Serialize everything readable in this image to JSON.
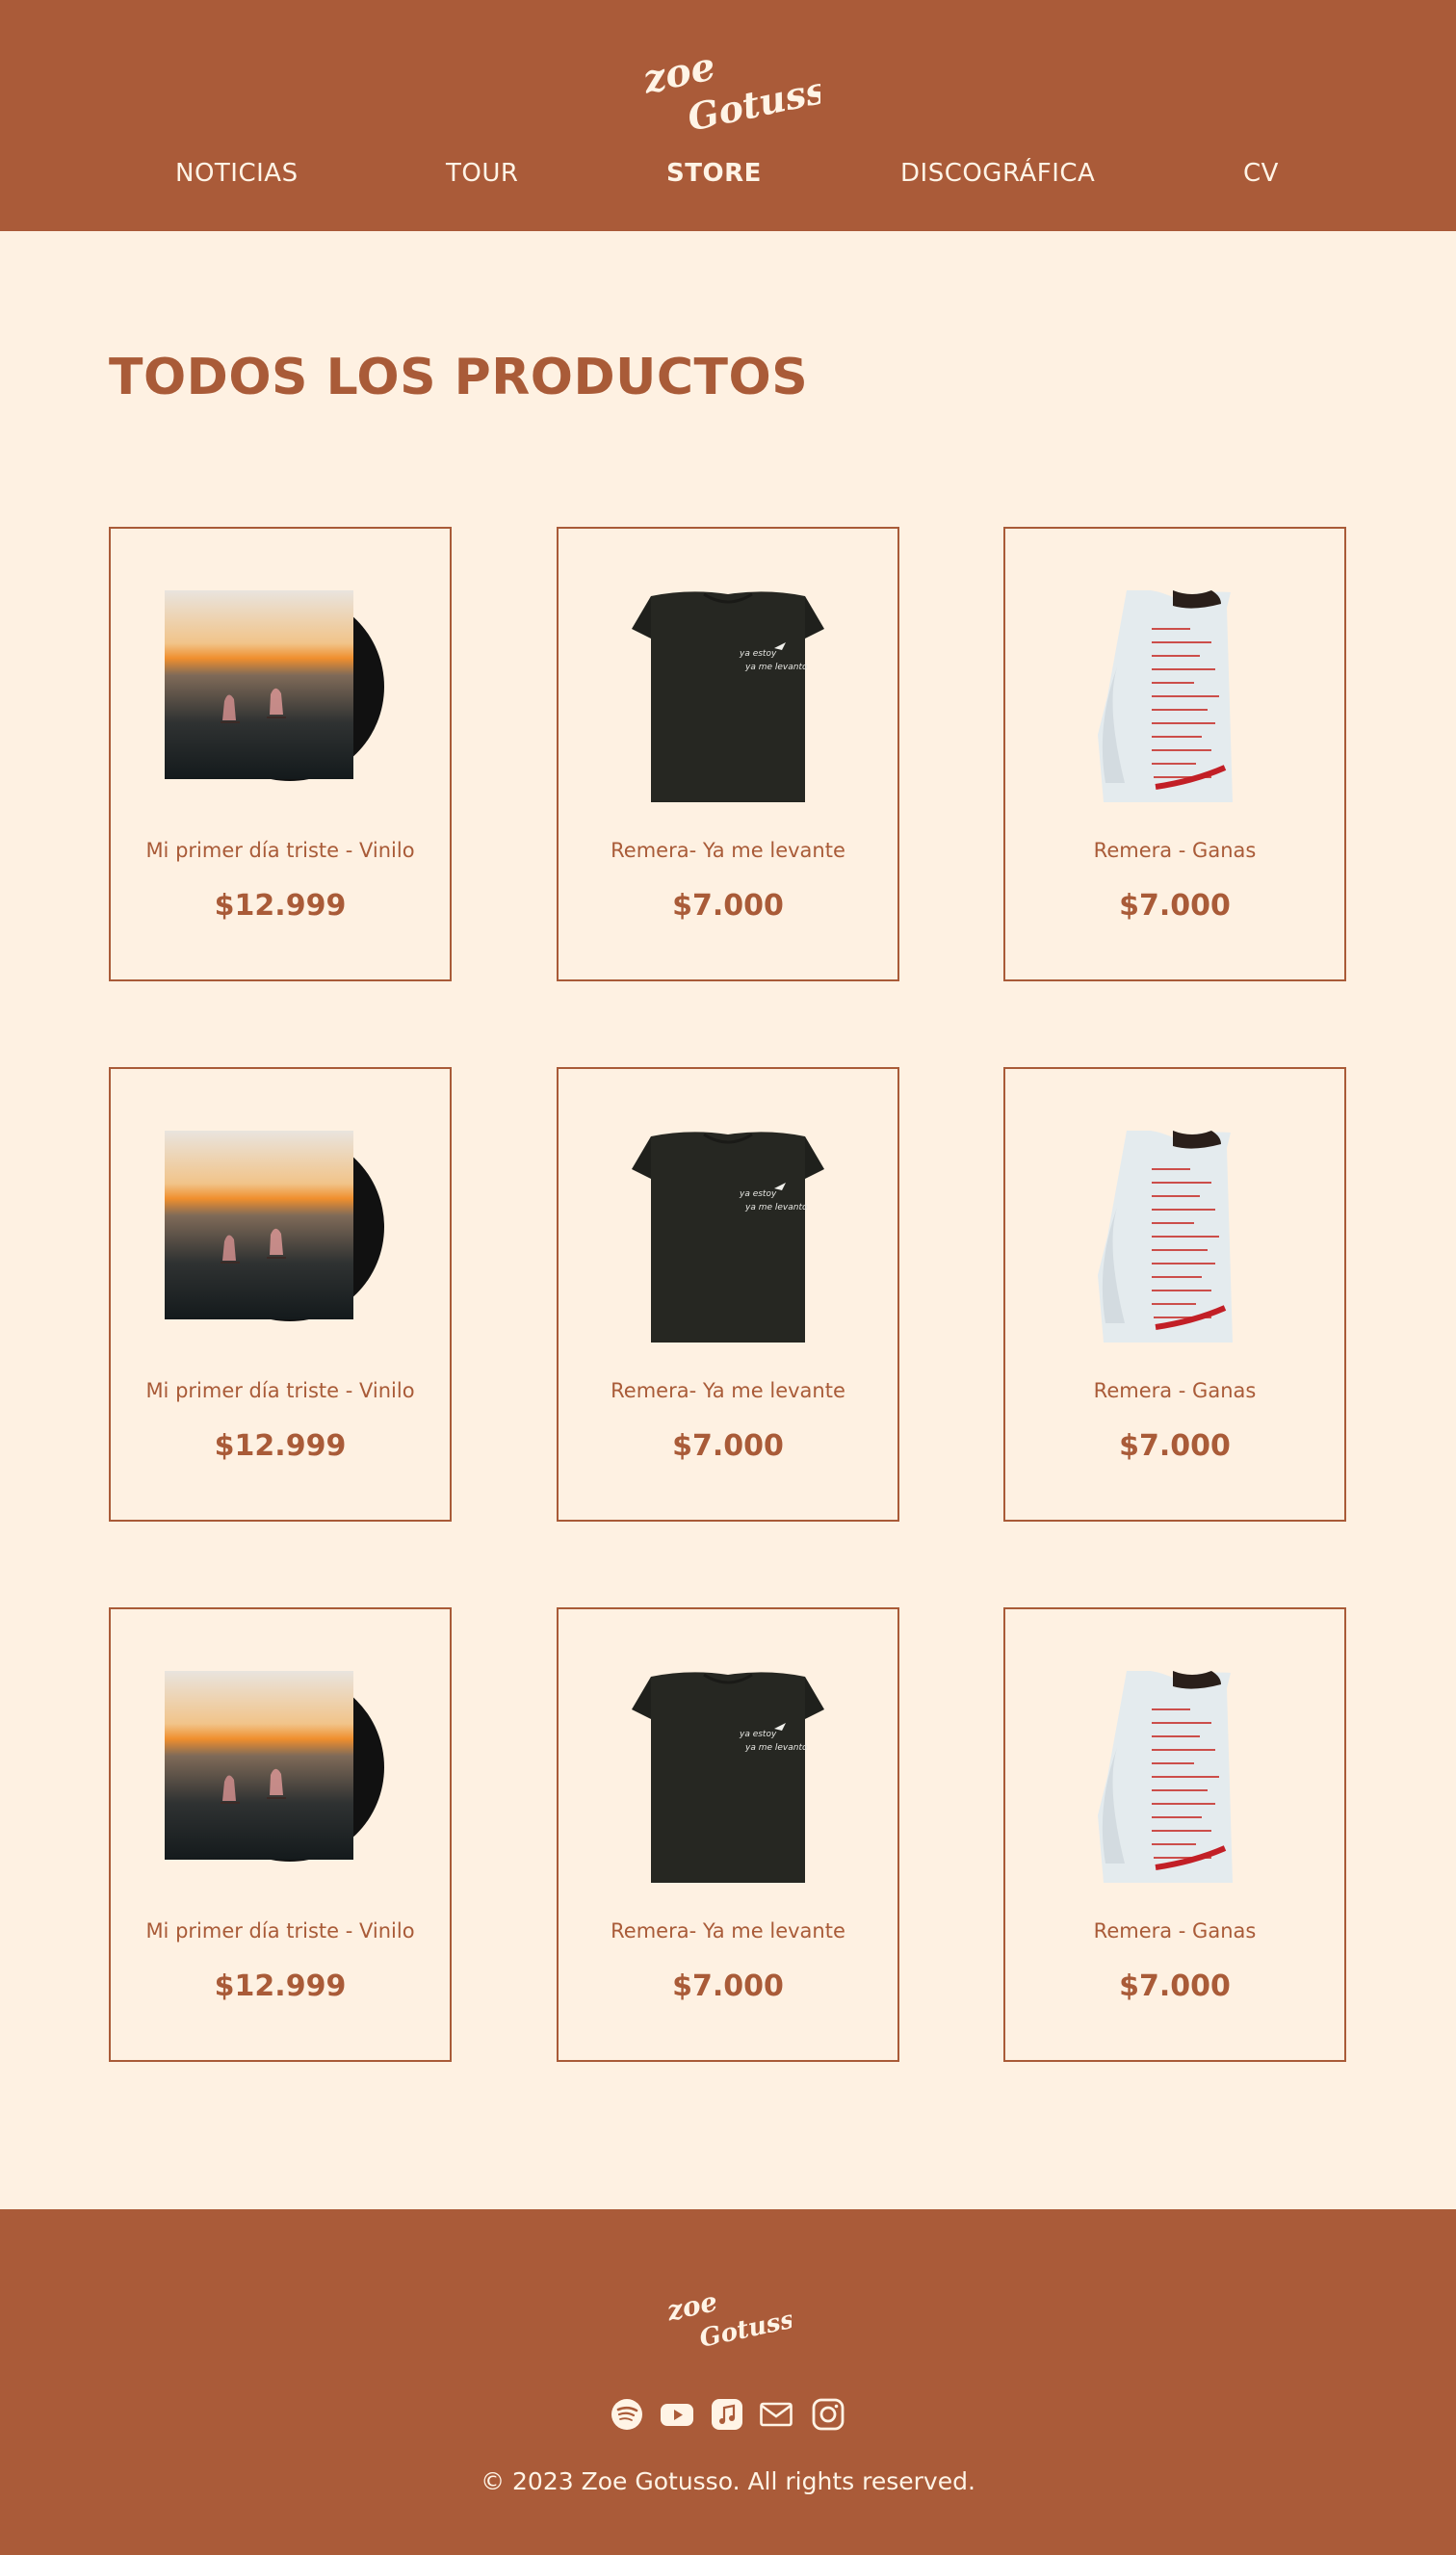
{
  "brand": {
    "logo_text_line1": "zoe",
    "logo_text_line2": "Gotusso"
  },
  "nav": {
    "items": [
      {
        "label": "NOTICIAS",
        "active": false
      },
      {
        "label": "TOUR",
        "active": false
      },
      {
        "label": "STORE",
        "active": true
      },
      {
        "label": "DISCOGRÁFICA",
        "active": false
      },
      {
        "label": "CV",
        "active": false
      }
    ]
  },
  "main": {
    "title": "TODOS LOS PRODUCTOS",
    "products": [
      {
        "name": "Mi primer día triste - Vinilo",
        "price": "$12.999",
        "kind": "vinyl"
      },
      {
        "name": "Remera- Ya me levante",
        "price": "$7.000",
        "kind": "black-shirt"
      },
      {
        "name": "Remera - Ganas",
        "price": "$7.000",
        "kind": "white-shirt"
      },
      {
        "name": "Mi primer día triste - Vinilo",
        "price": "$12.999",
        "kind": "vinyl"
      },
      {
        "name": "Remera- Ya me levante",
        "price": "$7.000",
        "kind": "black-shirt"
      },
      {
        "name": "Remera - Ganas",
        "price": "$7.000",
        "kind": "white-shirt"
      },
      {
        "name": "Mi primer día triste - Vinilo",
        "price": "$12.999",
        "kind": "vinyl"
      },
      {
        "name": "Remera- Ya me levante",
        "price": "$7.000",
        "kind": "black-shirt"
      },
      {
        "name": "Remera - Ganas",
        "price": "$7.000",
        "kind": "white-shirt"
      }
    ]
  },
  "footer": {
    "socials": [
      "spotify-icon",
      "youtube-icon",
      "apple-music-icon",
      "mail-icon",
      "instagram-icon"
    ],
    "copyright": "© 2023 Zoe Gotusso. All rights reserved."
  },
  "colors": {
    "brand": "#aa5b39",
    "background": "#fef1e2",
    "text_light": "#fff4e6"
  }
}
